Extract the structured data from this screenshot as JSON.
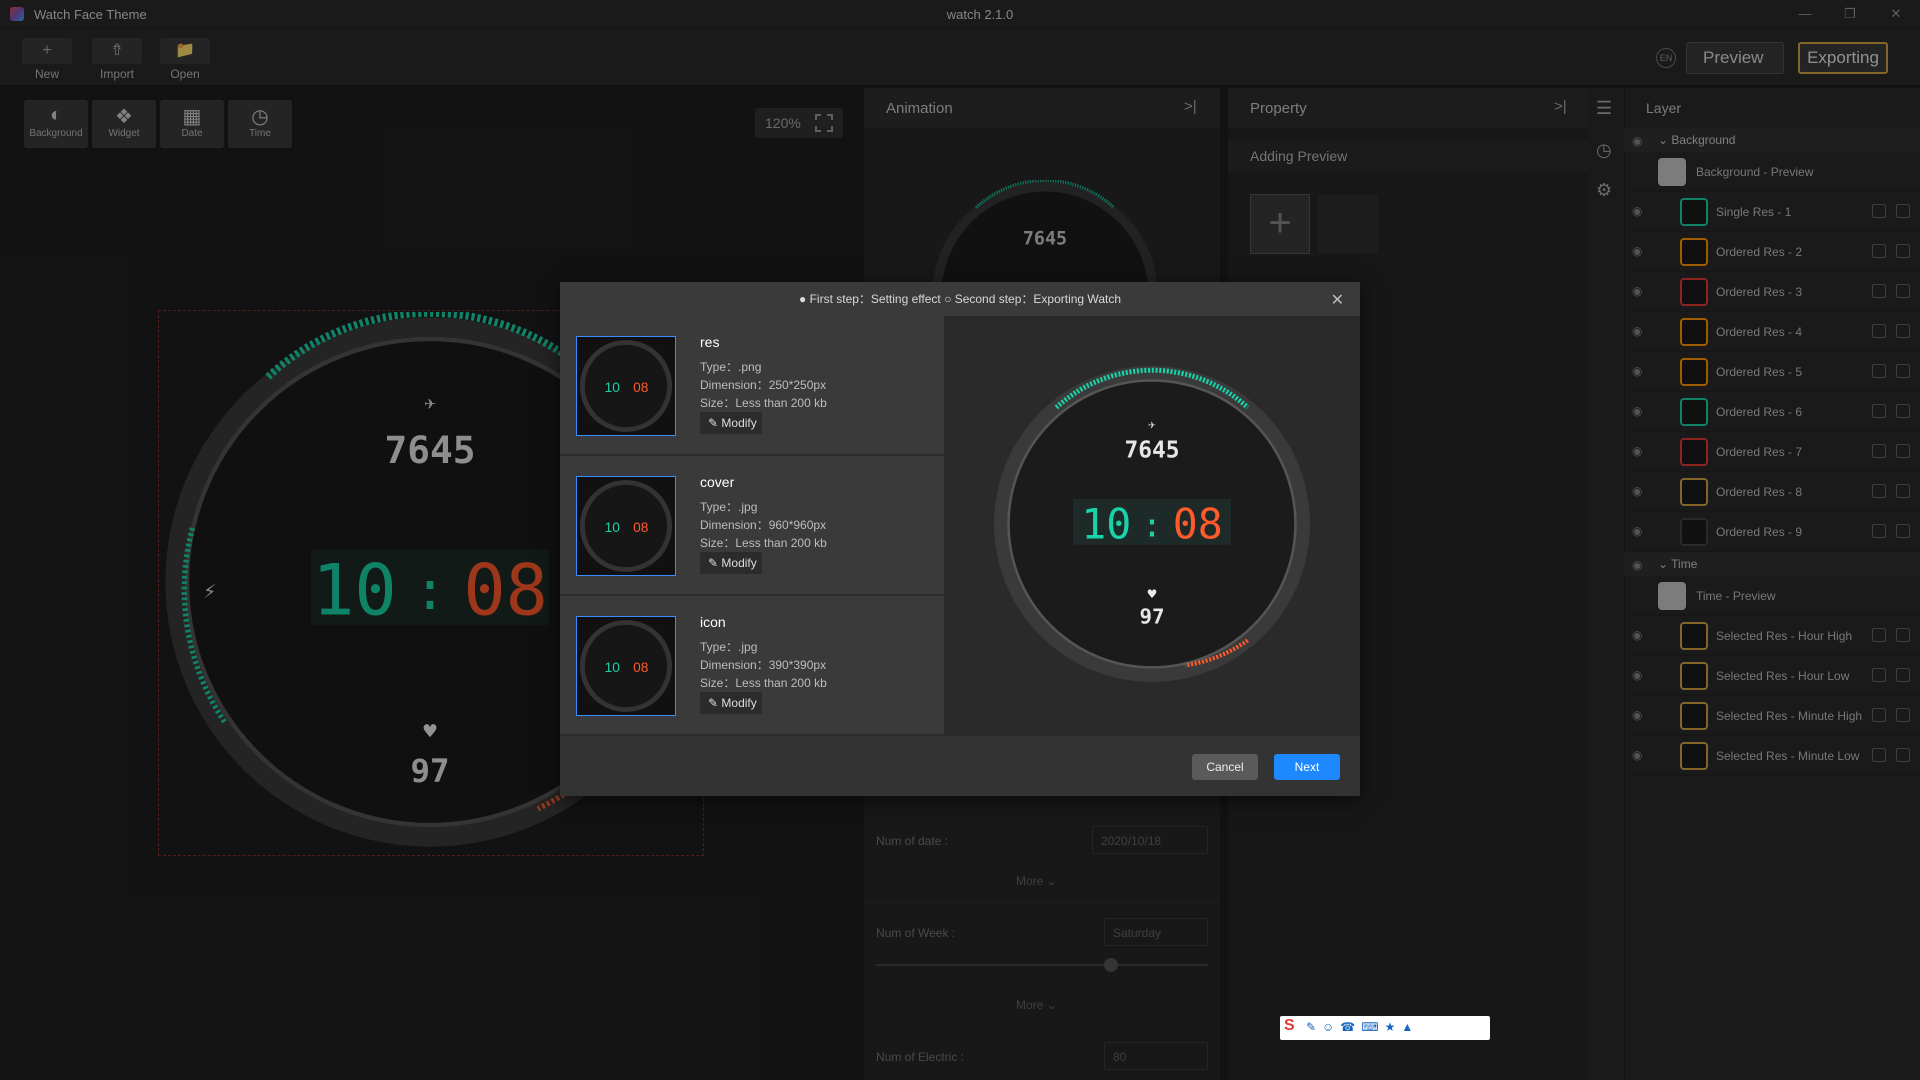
{
  "app": {
    "name": "Watch Face Theme",
    "window_title": "watch 2.1.0"
  },
  "toolbar": {
    "new_label": "New",
    "import_label": "Import",
    "open_label": "Open",
    "lang_label": "EN",
    "preview_label": "Preview",
    "exporting_label": "Exporting"
  },
  "tools": {
    "background": "Background",
    "widget": "Widget",
    "date": "Date",
    "time": "Time",
    "zoom": "120%"
  },
  "watch": {
    "steps": "7645",
    "hour": "10",
    "minute": "08",
    "heart": "97"
  },
  "panels": {
    "animation_title": "Animation",
    "property_title": "Property",
    "adding_preview": "Adding Preview",
    "num_of_date_label": "Num of date :",
    "num_of_date_value": "2020/10/18",
    "more_label": "More",
    "num_of_week_label": "Num of Week :",
    "num_of_week_value": "Saturday",
    "num_of_electric_label": "Num of Electric :",
    "num_of_electric_value": "80"
  },
  "layer": {
    "title": "Layer",
    "groups": [
      {
        "name": "Background",
        "preview": "Background - Preview",
        "items": [
          "Single Res - 1",
          "Ordered Res - 2",
          "Ordered Res - 3",
          "Ordered Res - 4",
          "Ordered Res - 5",
          "Ordered Res - 6",
          "Ordered Res - 7",
          "Ordered Res - 8",
          "Ordered Res - 9"
        ]
      },
      {
        "name": "Time",
        "preview": "Time - Preview",
        "items": [
          "Selected Res - Hour High",
          "Selected Res - Hour Low",
          "Selected Res - Minute High",
          "Selected Res - Minute Low"
        ]
      }
    ]
  },
  "modal": {
    "step1": "First step：Setting effect",
    "step2": "Second step：Exporting Watch",
    "assets": [
      {
        "name": "res",
        "type": "Type：.png",
        "dimension": "Dimension：250*250px",
        "size": "Size：Less than 200 kb",
        "modify": "Modify"
      },
      {
        "name": "cover",
        "type": "Type：.jpg",
        "dimension": "Dimension：960*960px",
        "size": "Size：Less than 200 kb",
        "modify": "Modify"
      },
      {
        "name": "icon",
        "type": "Type：.jpg",
        "dimension": "Dimension：390*390px",
        "size": "Size：Less than 200 kb",
        "modify": "Modify"
      }
    ],
    "cancel_label": "Cancel",
    "next_label": "Next"
  },
  "colors": {
    "accent": "#1e88ff",
    "export_border": "#d6a441",
    "teal": "#19d3a8",
    "orange": "#ff5a2b"
  }
}
